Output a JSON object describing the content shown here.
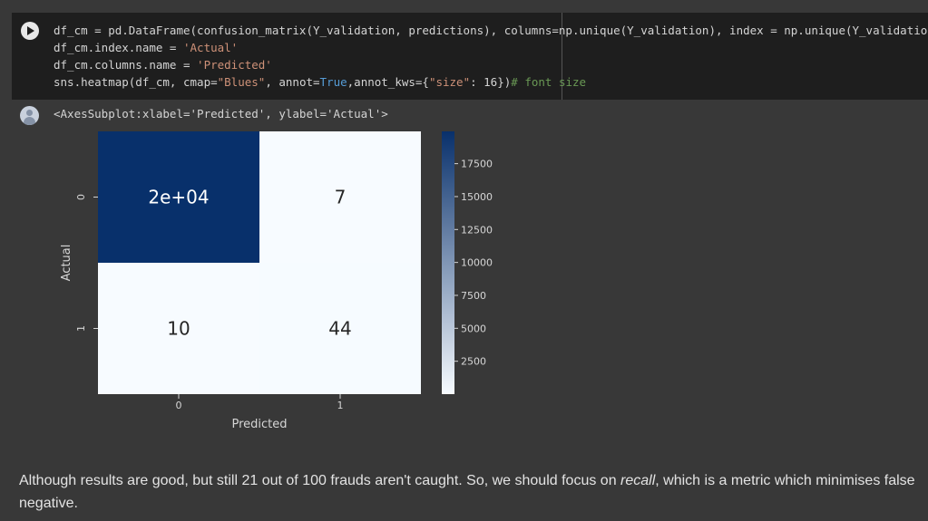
{
  "code_cell": {
    "lines": [
      [
        {
          "t": "df_cm = pd.DataFrame(confusion_matrix(Y_validation, predictions), columns=np.unique(Y_validation), index = np.unique(Y_validation))",
          "c": ""
        }
      ],
      [
        {
          "t": "df_cm.index.name = ",
          "c": ""
        },
        {
          "t": "'Actual'",
          "c": "str"
        }
      ],
      [
        {
          "t": "df_cm.columns.name = ",
          "c": ""
        },
        {
          "t": "'Predicted'",
          "c": "str"
        }
      ],
      [
        {
          "t": "sns.heatmap(df_cm, cmap=",
          "c": ""
        },
        {
          "t": "\"Blues\"",
          "c": "str"
        },
        {
          "t": ", annot=",
          "c": ""
        },
        {
          "t": "True",
          "c": "kw"
        },
        {
          "t": ",annot_kws={",
          "c": ""
        },
        {
          "t": "\"size\"",
          "c": "str"
        },
        {
          "t": ": 16})",
          "c": ""
        },
        {
          "t": "# font size",
          "c": "cmt"
        }
      ]
    ]
  },
  "output": {
    "text": "<AxesSubplot:xlabel='Predicted', ylabel='Actual'>"
  },
  "chart_data": {
    "type": "heatmap",
    "xlabel": "Predicted",
    "ylabel": "Actual",
    "x_categories": [
      "0",
      "1"
    ],
    "y_categories": [
      "0",
      "1"
    ],
    "values": [
      [
        19950,
        7
      ],
      [
        10,
        44
      ]
    ],
    "annotations": [
      [
        "2e+04",
        "7"
      ],
      [
        "10",
        "44"
      ]
    ],
    "colormap": "Blues",
    "color_range": [
      0,
      19950
    ],
    "colorbar_ticks": [
      2500,
      5000,
      7500,
      10000,
      12500,
      15000,
      17500
    ],
    "colors": {
      "low": "#f7fbff",
      "high": "#08306b",
      "annot_light": "#ffffff",
      "annot_dark": "#262626",
      "axis_text": "#d6d6d6"
    }
  },
  "prose": {
    "before": "Although results are good, but still 21 out of 100 frauds aren't caught. So, we should focus on ",
    "emphasis": "recall",
    "after": ", which is a metric which minimises false negative."
  }
}
